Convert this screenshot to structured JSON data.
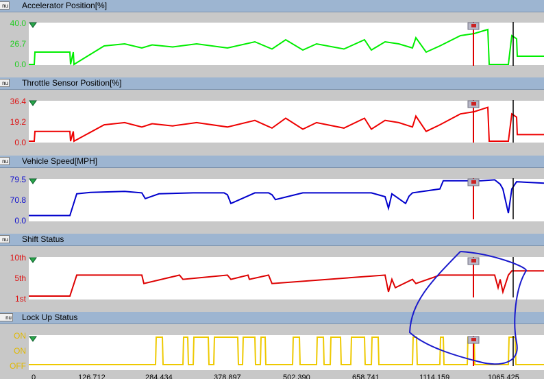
{
  "panels": [
    {
      "id": "accel",
      "menu_label": "nu",
      "title": "Accelerator Position[%]",
      "color": "#00ee00",
      "ylim": [
        0.0,
        40.0
      ],
      "y_ticks": [
        "40.0",
        "26.7",
        "0.0"
      ]
    },
    {
      "id": "throttle",
      "menu_label": "nu",
      "title": "Throttle Sensor Position[%]",
      "color": "#ee0000",
      "ylim": [
        0.0,
        36.4
      ],
      "y_ticks": [
        "36.4",
        "19.2",
        "0.0"
      ]
    },
    {
      "id": "speed",
      "menu_label": "nu",
      "title": "Vehicle Speed[MPH]",
      "color": "#0000cc",
      "ylim": [
        0.0,
        79.5
      ],
      "y_ticks": [
        "79.5",
        "70.8",
        "0.0"
      ]
    },
    {
      "id": "shift",
      "menu_label": "nu",
      "title": "Shift Status",
      "color": "#dd0000",
      "ylim": [
        1,
        10
      ],
      "y_ticks": [
        "10th",
        "5th",
        "1st"
      ]
    },
    {
      "id": "lockup",
      "menu_label": "nu",
      "title": "Lock Up Status",
      "color": "#eec900",
      "ylim": [
        0,
        2
      ],
      "y_ticks": [
        "ON",
        "ON",
        "OFF"
      ]
    }
  ],
  "x_ticks": [
    "0",
    "126.712",
    "284.434",
    "378.897",
    "502.390",
    "658.741",
    "1114.159",
    "1065.425"
  ],
  "cursor_colors": {
    "red_cursor": "#dd0000",
    "black_cursor": "#000000",
    "annotation": "#1a1acc"
  },
  "chart_data": [
    {
      "type": "line",
      "title": "Accelerator Position[%]",
      "ylim": [
        0.0,
        40.0
      ],
      "series": [
        {
          "name": "Accelerator Position[%]",
          "x": [
            0,
            8,
            9,
            60,
            61,
            65,
            66,
            110,
            140,
            165,
            180,
            210,
            245,
            290,
            330,
            355,
            375,
            400,
            420,
            460,
            490,
            500,
            520,
            540,
            560,
            565,
            580,
            600,
            630,
            650,
            660,
            670,
            672,
            700,
            705,
            712,
            713,
            740,
            752
          ],
          "y": [
            0,
            0,
            12,
            12,
            0,
            12,
            0,
            18,
            20,
            16,
            19,
            17,
            20,
            16,
            22,
            15,
            24,
            14,
            20,
            15,
            24,
            14,
            22,
            20,
            16,
            26,
            12,
            18,
            28,
            30,
            32,
            34,
            0,
            0,
            28,
            25,
            8,
            8,
            8
          ]
        }
      ]
    },
    {
      "type": "line",
      "title": "Throttle Sensor Position[%]",
      "ylim": [
        0.0,
        36.4
      ],
      "series": [
        {
          "name": "Throttle Sensor Position[%]",
          "x": [
            0,
            8,
            9,
            60,
            61,
            65,
            66,
            110,
            140,
            165,
            180,
            210,
            245,
            290,
            330,
            355,
            375,
            400,
            420,
            460,
            490,
            500,
            520,
            540,
            560,
            565,
            580,
            600,
            630,
            650,
            660,
            670,
            672,
            700,
            705,
            712,
            713,
            740,
            752
          ],
          "y": [
            0,
            0,
            9,
            9,
            0,
            9,
            0,
            15,
            17,
            13,
            16,
            14,
            17,
            13,
            19,
            12,
            21,
            11,
            17,
            12,
            21,
            11,
            19,
            17,
            13,
            23,
            9,
            15,
            25,
            27,
            29,
            31,
            0,
            0,
            25,
            22,
            6,
            6,
            6
          ]
        }
      ]
    },
    {
      "type": "line",
      "title": "Vehicle Speed[MPH]",
      "ylim": [
        0.0,
        79.5
      ],
      "series": [
        {
          "name": "Vehicle Speed[MPH]",
          "x": [
            0,
            60,
            70,
            90,
            140,
            165,
            170,
            190,
            240,
            285,
            290,
            295,
            330,
            350,
            355,
            360,
            400,
            500,
            520,
            525,
            530,
            540,
            550,
            555,
            560,
            600,
            605,
            660,
            680,
            688,
            692,
            700,
            705,
            712,
            752
          ],
          "y": [
            5,
            5,
            50,
            53,
            55,
            52,
            40,
            50,
            52,
            52,
            48,
            30,
            52,
            52,
            48,
            38,
            52,
            52,
            44,
            20,
            50,
            40,
            30,
            45,
            52,
            60,
            77,
            77,
            79,
            70,
            60,
            10,
            60,
            75,
            72
          ]
        }
      ]
    },
    {
      "type": "line",
      "title": "Shift Status",
      "ylim": [
        1,
        10
      ],
      "series": [
        {
          "name": "Shift Status",
          "x": [
            0,
            60,
            70,
            165,
            168,
            220,
            225,
            290,
            295,
            320,
            322,
            350,
            355,
            520,
            525,
            530,
            535,
            560,
            565,
            600,
            620,
            680,
            685,
            688,
            692,
            700,
            705,
            752
          ],
          "y": [
            1,
            1,
            6,
            6,
            4,
            6,
            5,
            6,
            5,
            6,
            5,
            6,
            4,
            6,
            2,
            5,
            3,
            5,
            4,
            6,
            6,
            6,
            3,
            5,
            2,
            6,
            7,
            7
          ]
        }
      ]
    },
    {
      "type": "line",
      "title": "Lock Up Status",
      "ylim": [
        0,
        2
      ],
      "series": [
        {
          "name": "Lock Up Status",
          "x": [
            0,
            185,
            186,
            195,
            196,
            225,
            226,
            232,
            233,
            240,
            241,
            262,
            263,
            270,
            271,
            305,
            306,
            312,
            313,
            330,
            331,
            338,
            339,
            345,
            346,
            385,
            386,
            395,
            396,
            420,
            421,
            430,
            431,
            440,
            441,
            455,
            456,
            470,
            471,
            490,
            491,
            500,
            501,
            510,
            511,
            560,
            561,
            566,
            567,
            600,
            601,
            605,
            606,
            640,
            641,
            650,
            651,
            700,
            701,
            710,
            711,
            752
          ],
          "y": [
            0,
            0,
            2,
            2,
            0,
            0,
            2,
            2,
            0,
            0,
            2,
            2,
            0,
            0,
            2,
            2,
            0,
            0,
            2,
            2,
            0,
            0,
            2,
            2,
            0,
            0,
            2,
            2,
            0,
            0,
            2,
            2,
            0,
            0,
            2,
            2,
            0,
            0,
            2,
            2,
            0,
            0,
            2,
            2,
            0,
            0,
            2,
            2,
            0,
            0,
            2,
            2,
            0,
            0,
            2,
            2,
            0,
            0,
            2,
            2,
            0,
            0
          ]
        }
      ]
    }
  ]
}
